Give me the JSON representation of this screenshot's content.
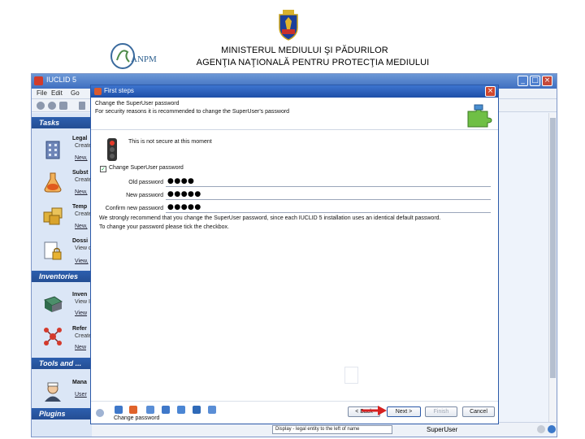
{
  "slide": {
    "header_line1": "MINISTERUL MEDIULUI ŞI PĂDURILOR",
    "header_line2": "AGENŢIA NAŢIONALĂ PENTRU PROTECŢIA MEDIULUI",
    "logo_text": "ANPM"
  },
  "app": {
    "title": "IUCLID 5",
    "menu": [
      "File",
      "Edit",
      "Go"
    ],
    "left_panel": {
      "sections": {
        "tasks": "Tasks",
        "inventories": "Inventories",
        "tools": "Tools and ...",
        "plugins": "Plugins"
      },
      "items": [
        {
          "title": "Legal",
          "sub": "Create",
          "link": "New,"
        },
        {
          "title": "Subst",
          "sub": "Create",
          "link": "New,"
        },
        {
          "title": "Temp",
          "sub": "Create",
          "link": "New,"
        },
        {
          "title": "Dossi",
          "sub": "View d",
          "link": "View,"
        },
        {
          "title": "Inven",
          "sub": "View I",
          "link": "View"
        },
        {
          "title": "Refer",
          "sub": "Create",
          "link": "New"
        },
        {
          "title": "Mana",
          "sub": "",
          "link": "User"
        }
      ]
    },
    "status": {
      "language": "Display - legal entity to the left of name",
      "user": "SuperUser"
    }
  },
  "dialog": {
    "title": "First steps",
    "heading": "Change the SuperUser password",
    "subheading": "For security reasons it is recommended to change the SuperUser's password",
    "warning": "This is not secure at this moment",
    "checkbox_label": "Change SuperUser password",
    "checkbox_checked": true,
    "fields": {
      "old_label": "Old password",
      "old_value": "●●●●",
      "new_label": "New password",
      "new_value": "●●●●●",
      "confirm_label": "Confirm new password",
      "confirm_value": "●●●●●"
    },
    "recommendation_line1": "We strongly recommend that you change the SuperUser password, since each IUCLID 5 installation uses an identical default password.",
    "recommendation_line2": "To change your password please tick the checkbox.",
    "step_label": "Change password",
    "buttons": {
      "back": "< Back",
      "next": "Next >",
      "finish": "Finish",
      "cancel": "Cancel"
    }
  },
  "colors": {
    "title_bar": "#3f6fc0",
    "section_header": "#2d5fae",
    "left_panel_bg": "#dbe6f6",
    "arrow": "#d62020"
  }
}
